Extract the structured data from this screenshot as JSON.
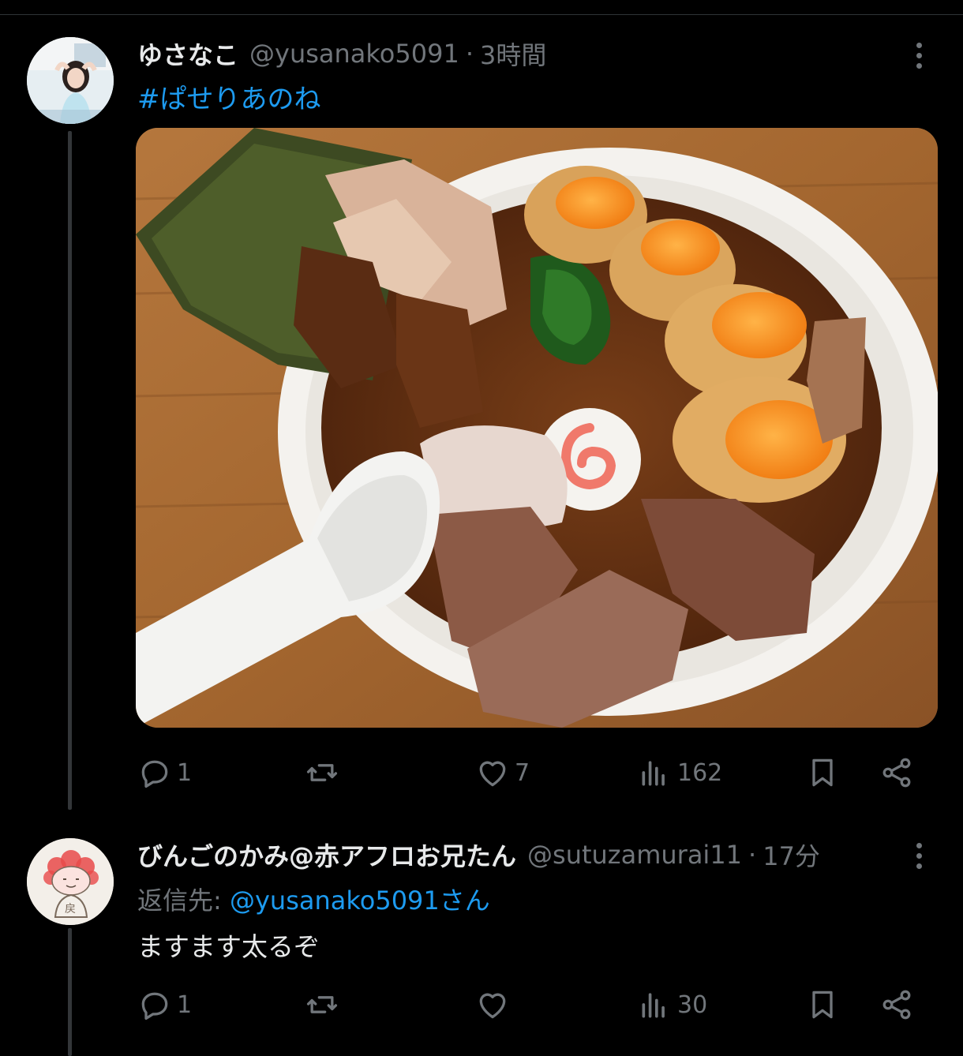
{
  "tweet": {
    "display_name": "ゆさなこ",
    "handle": "@yusanako5091",
    "separator": "·",
    "time": "3時間",
    "text": "#ぱせりあのね",
    "image_icon": "ramen-photo",
    "actions": {
      "reply_count": "1",
      "retweet_count": "",
      "like_count": "7",
      "view_count": "162"
    }
  },
  "reply": {
    "display_name": "びんごのかみ@赤アフロお兄たん",
    "handle": "@sutuzamurai11",
    "separator": "·",
    "time": "17分",
    "reply_to_label": "返信先: ",
    "reply_to_mention": "@yusanako5091さん",
    "text": "ますます太るぞ",
    "actions": {
      "reply_count": "1",
      "retweet_count": "",
      "like_count": "",
      "view_count": "30"
    }
  },
  "colors": {
    "background": "#000000",
    "text_primary": "#e7e9ea",
    "text_secondary": "#71767b",
    "link": "#1d9bf0",
    "divider": "#2f3336"
  },
  "icons": [
    "reply-icon",
    "retweet-icon",
    "like-icon",
    "views-icon",
    "bookmark-icon",
    "share-icon",
    "more-icon"
  ]
}
